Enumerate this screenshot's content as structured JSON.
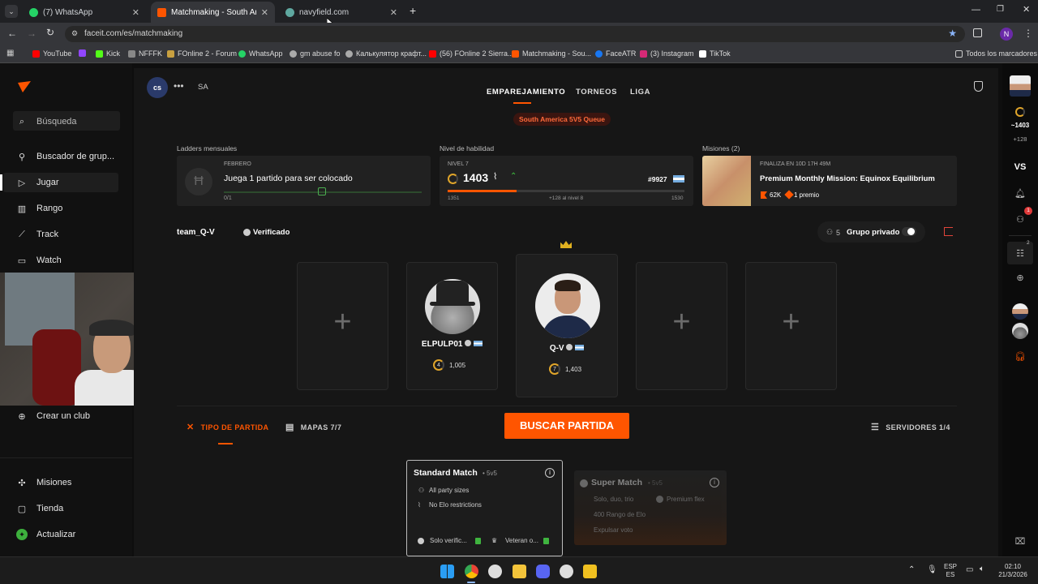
{
  "browser": {
    "tabs": [
      {
        "title": "(7) WhatsApp",
        "color": "#25d366"
      },
      {
        "title": "Matchmaking - South America",
        "color": "#ff5500"
      },
      {
        "title": "navyfield.com",
        "color": "#5fa8a0"
      }
    ],
    "url": "faceit.com/es/matchmaking",
    "bookmarks": [
      {
        "label": "YouTube",
        "color": "#ff0000"
      },
      {
        "label": "Kick",
        "color": "#53fc18"
      },
      {
        "label": "NFFFK",
        "color": "#888888"
      },
      {
        "label": "FOnline 2 - Forum",
        "color": "#c8a040"
      },
      {
        "label": "WhatsApp",
        "color": "#25d366"
      },
      {
        "label": "gm abuse fo",
        "color": "#aaaaaa"
      },
      {
        "label": "Калькулятор крафт...",
        "color": "#aaaaaa"
      },
      {
        "label": "(56) FOnline 2 Sierra...",
        "color": "#ff0000"
      },
      {
        "label": "Matchmaking - Sou...",
        "color": "#ff5500"
      },
      {
        "label": "FaceATR",
        "color": "#1877f2"
      },
      {
        "label": "(3) Instagram",
        "color": "#d62976"
      },
      {
        "label": "TikTok",
        "color": "#ffffff"
      }
    ],
    "all_bookmarks": "Todos los marcadores",
    "profile_initial": "N"
  },
  "sidebar": {
    "search": "Búsqueda",
    "items": [
      {
        "label": "Buscador de grup...",
        "icon": "group-search-icon"
      },
      {
        "label": "Jugar",
        "icon": "play-icon"
      },
      {
        "label": "Rango",
        "icon": "ranking-icon"
      },
      {
        "label": "Track",
        "icon": "track-icon"
      },
      {
        "label": "Watch",
        "icon": "watch-icon"
      }
    ],
    "create_club": "Crear un club",
    "missions": "Misiones",
    "store": "Tienda",
    "upgrade": "Actualizar"
  },
  "header": {
    "game_badge": "cs",
    "region": "SA",
    "nav": [
      "EMPAREJAMIENTO",
      "TORNEOS",
      "LIGA"
    ],
    "queue": "South America 5V5 Queue"
  },
  "ladders": {
    "title": "Ladders mensuales",
    "month": "FEBRERO",
    "text": "Juega 1 partido para ser colocado",
    "progress": "0/1"
  },
  "skill": {
    "title": "Nivel de habilidad",
    "level": "NIVEL 7",
    "elo": "1403",
    "rank": "#9927",
    "min": "1351",
    "to_next": "+128 al nivel 8",
    "max": "1530",
    "progress_fraction": 0.29
  },
  "missions_card": {
    "title": "Misiones (2)",
    "ends": "FINALIZA EN 10D 17H 49M",
    "name": "Premium Monthly Mission: Equinox Equilibrium",
    "reward_points": "62K",
    "reward_prize": "1 premio"
  },
  "team": {
    "name": "team_Q-V",
    "verified": "Verificado",
    "party_count": "5",
    "private_group": "Grupo privado",
    "players": [
      {
        "name": "ELPULP01",
        "level": "4",
        "elo": "1,005"
      },
      {
        "name": "Q-V",
        "level": "7",
        "elo": "1,403"
      }
    ]
  },
  "match": {
    "tab_type": "TIPO DE PARTIDA",
    "tab_maps": "MAPAS 7/7",
    "find_button": "BUSCAR PARTIDA",
    "servers": "SERVIDORES 1/4",
    "standard": {
      "title": "Standard Match",
      "mode": "• 5v5",
      "line1": "All party sizes",
      "line2": "No Elo restrictions",
      "tag1": "Solo verific...",
      "tag2": "Veteran o..."
    },
    "super": {
      "title": "Super Match",
      "mode": "• 5v5",
      "line1": "Solo, duo, trio",
      "line2": "Premium flex",
      "line3": "400 Rango de Elo",
      "line4": "Expulsar voto"
    }
  },
  "rightbar": {
    "elo": "~1403",
    "delta": "+128",
    "vs": "VS",
    "notif_count": "1",
    "club_count": "2"
  },
  "taskbar": {
    "lang1": "ESP",
    "lang2": "ES",
    "time": "02:10",
    "date": "21/3/2026"
  }
}
